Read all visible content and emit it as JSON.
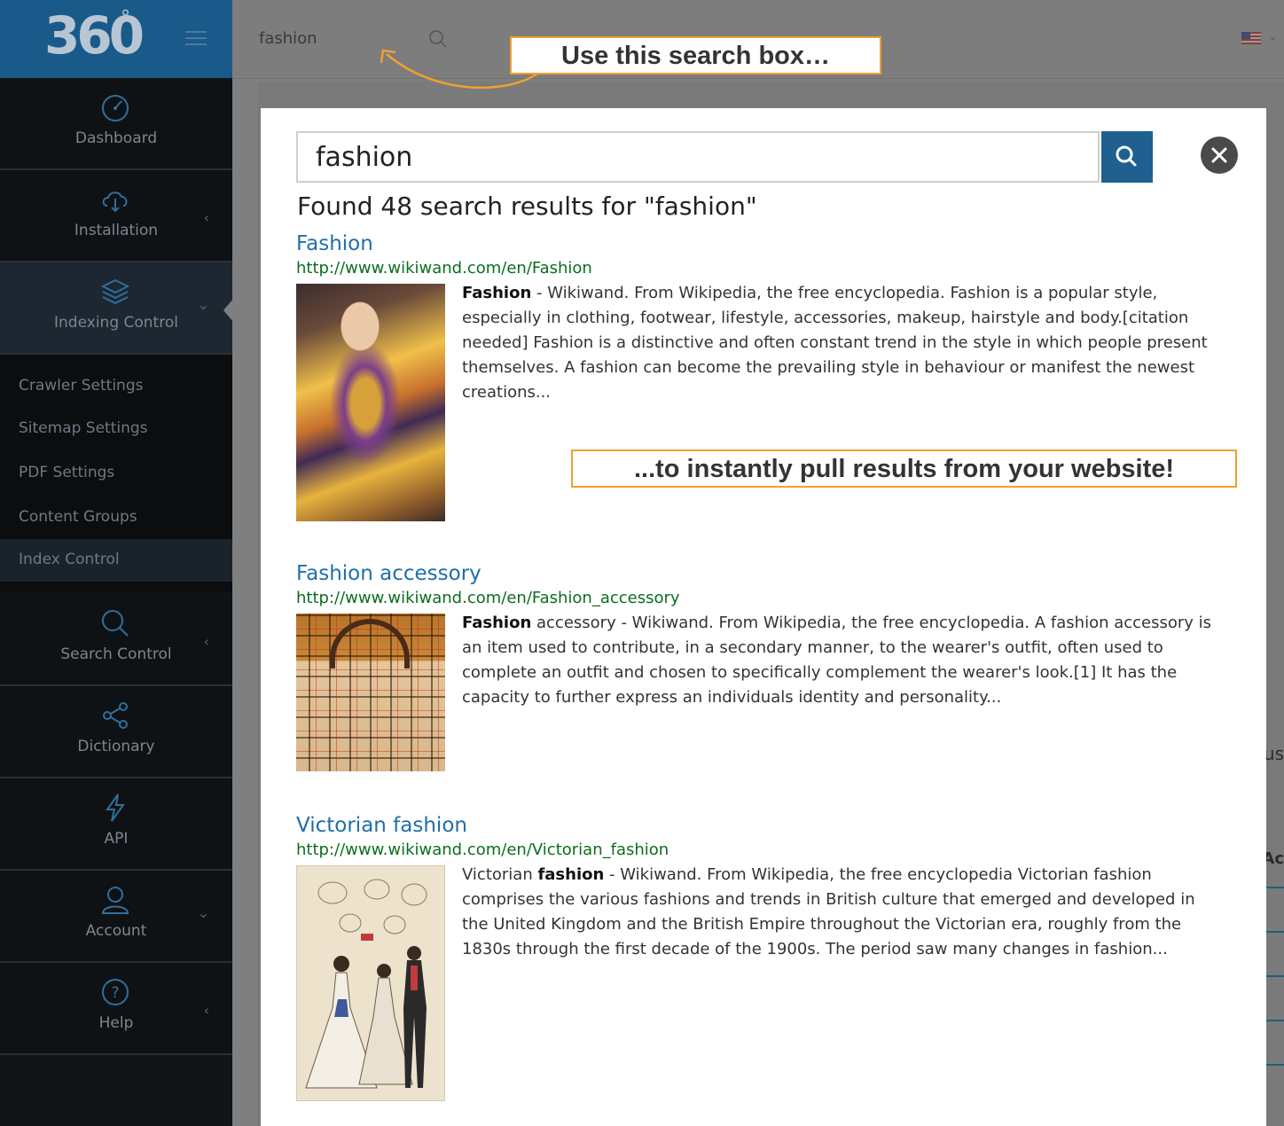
{
  "sidebar": {
    "logo": "360",
    "logo_degree": "°",
    "items": [
      {
        "label": "Dashboard",
        "icon": "speedometer-icon",
        "has_chevron": false
      },
      {
        "label": "Installation",
        "icon": "cloud-download-icon",
        "has_chevron": true,
        "chevron": "‹"
      },
      {
        "label": "Indexing Control",
        "icon": "layers-icon",
        "has_chevron": true,
        "chevron": "⌄",
        "active": true
      },
      {
        "label": "Search Control",
        "icon": "search-icon",
        "has_chevron": true,
        "chevron": "‹"
      },
      {
        "label": "Dictionary",
        "icon": "share-icon",
        "has_chevron": false
      },
      {
        "label": "API",
        "icon": "bolt-icon",
        "has_chevron": false
      },
      {
        "label": "Account",
        "icon": "user-icon",
        "has_chevron": true,
        "chevron": "⌄"
      },
      {
        "label": "Help",
        "icon": "help-circle-icon",
        "has_chevron": true,
        "chevron": "‹"
      }
    ],
    "sub_items": [
      {
        "label": "Crawler Settings"
      },
      {
        "label": "Sitemap Settings"
      },
      {
        "label": "PDF Settings"
      },
      {
        "label": "Content Groups"
      },
      {
        "label": "Index Control",
        "current": true
      }
    ]
  },
  "topbar": {
    "search_value": "fashion",
    "flag": "us-flag-icon",
    "flag_chevron": "⌄"
  },
  "background": {
    "partial_text_1": "us",
    "partial_text_2": "Ac"
  },
  "modal": {
    "search_value": "fashion",
    "results_heading": "Found 48 search results for \"fashion\"",
    "results": [
      {
        "title": "Fashion",
        "url": "http://www.wikiwand.com/en/Fashion",
        "snippet_bold": "Fashion",
        "snippet": " - Wikiwand. From Wikipedia, the free encyclopedia. Fashion is a popular style, especially in clothing, footwear, lifestyle, accessories, makeup, hairstyle and body.[citation needed] Fashion is a distinctive and often constant trend in the style in which people present themselves. A fashion can become the prevailing style in behaviour or manifest the newest creations..."
      },
      {
        "title": "Fashion accessory",
        "url": "http://www.wikiwand.com/en/Fashion_accessory",
        "snippet_bold": "Fashion",
        "snippet": " accessory - Wikiwand. From Wikipedia, the free encyclopedia. A fashion accessory is an item used to contribute, in a secondary manner, to the wearer's outfit, often used to complete an outfit and chosen to specifically complement the wearer's look.[1] It has the capacity to further express an individuals identity and personality..."
      },
      {
        "title": "Victorian fashion",
        "url": "http://www.wikiwand.com/en/Victorian_fashion",
        "snippet_pre": "Victorian ",
        "snippet_bold": "fashion",
        "snippet": " - Wikiwand. From Wikipedia, the free encyclopedia Victorian fashion comprises the various fashions and trends in British culture that emerged and developed in the United Kingdom and the British Empire throughout the Victorian era, roughly from the 1830s through the first decade of the 1900s. The period saw many changes in fashion..."
      }
    ]
  },
  "annotations": {
    "callout_1": "Use this search box…",
    "callout_2": "...to instantly pull results from your website!",
    "accent_color": "#f0a030"
  },
  "colors": {
    "sidebar_bg": "#121518",
    "logo_bg": "#1a5a8a",
    "link_blue": "#1f6fa8",
    "url_green": "#0b6e1e",
    "search_button": "#1f6091"
  }
}
